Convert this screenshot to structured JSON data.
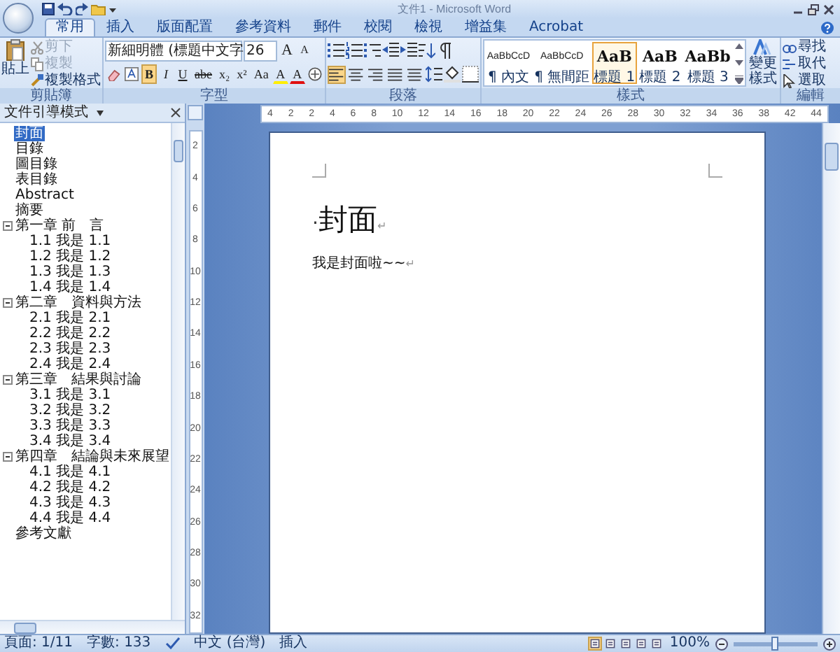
{
  "window": {
    "title": "文件1 - Microsoft Word"
  },
  "tabs": [
    {
      "label": "常用",
      "selected": true
    },
    {
      "label": "插入",
      "selected": false
    },
    {
      "label": "版面配置",
      "selected": false
    },
    {
      "label": "參考資料",
      "selected": false
    },
    {
      "label": "郵件",
      "selected": false
    },
    {
      "label": "校閱",
      "selected": false
    },
    {
      "label": "檢視",
      "selected": false
    },
    {
      "label": "增益集",
      "selected": false
    },
    {
      "label": "Acrobat",
      "selected": false
    }
  ],
  "ribbon": {
    "clipboard": {
      "label": "剪貼簿",
      "paste": "貼上",
      "items": [
        {
          "label": "剪下",
          "disabled": true
        },
        {
          "label": "複製",
          "disabled": true
        },
        {
          "label": "複製格式",
          "disabled": false
        }
      ]
    },
    "font": {
      "label": "字型",
      "font_name": "新細明體 (標題中文字",
      "font_size": "26",
      "size_buttons": [
        "A",
        "A"
      ],
      "format_buttons": [
        {
          "label": "B",
          "selected": true
        },
        {
          "label": "I",
          "selected": false
        },
        {
          "label": "U",
          "selected": false
        },
        {
          "label": "abe",
          "selected": false
        },
        {
          "label": "x₂",
          "selected": false
        },
        {
          "label": "x²",
          "selected": false
        },
        {
          "label": "Aa",
          "selected": false
        }
      ],
      "color_buttons": [
        "A",
        "A"
      ]
    },
    "paragraph": {
      "label": "段落",
      "alignment": [
        {
          "selected": true
        },
        {
          "selected": false
        },
        {
          "selected": false
        },
        {
          "selected": false
        },
        {
          "selected": false
        }
      ]
    },
    "styles": {
      "label": "樣式",
      "items": [
        {
          "preview": "AaBbCcD",
          "name": "¶ 內文",
          "kind": "body",
          "selected": false
        },
        {
          "preview": "AaBbCcD",
          "name": "¶ 無間距",
          "kind": "body",
          "selected": false
        },
        {
          "preview": "AaB",
          "name": "標題 1",
          "kind": "heading",
          "selected": true
        },
        {
          "preview": "AaB",
          "name": "標題 2",
          "kind": "heading",
          "selected": false
        },
        {
          "preview": "AaBb",
          "name": "標題 3",
          "kind": "heading",
          "selected": false
        }
      ],
      "change_styles": "變更樣式"
    },
    "editing": {
      "label": "編輯",
      "items": [
        "尋找",
        "取代",
        "選取"
      ]
    }
  },
  "nav_pane": {
    "mode": "文件引導模式",
    "items": [
      {
        "label": "封面",
        "selected": true
      },
      {
        "label": "目錄",
        "selected": false
      },
      {
        "label": "圖目錄",
        "selected": false
      },
      {
        "label": "表目錄",
        "selected": false
      },
      {
        "label": "Abstract",
        "selected": false
      },
      {
        "label": "摘要",
        "selected": false
      },
      {
        "label": "第一章 前　言",
        "selected": false,
        "expanded": true,
        "children": [
          {
            "label": "1.1 我是 1.1",
            "selected": false
          },
          {
            "label": "1.2 我是 1.2",
            "selected": false
          },
          {
            "label": "1.3 我是 1.3",
            "selected": false
          },
          {
            "label": "1.4 我是 1.4",
            "selected": false
          }
        ]
      },
      {
        "label": "第二章　資料與方法",
        "selected": false,
        "expanded": true,
        "children": [
          {
            "label": "2.1 我是 2.1",
            "selected": false
          },
          {
            "label": "2.2 我是 2.2",
            "selected": false
          },
          {
            "label": "2.3 我是 2.3",
            "selected": false
          },
          {
            "label": "2.4 我是 2.4",
            "selected": false
          }
        ]
      },
      {
        "label": "第三章　結果與討論",
        "selected": false,
        "expanded": true,
        "children": [
          {
            "label": "3.1 我是 3.1",
            "selected": false
          },
          {
            "label": "3.2 我是 3.2",
            "selected": false
          },
          {
            "label": "3.3 我是 3.3",
            "selected": false
          },
          {
            "label": "3.4 我是 3.4",
            "selected": false
          }
        ]
      },
      {
        "label": "第四章　結論與未來展望",
        "selected": false,
        "expanded": true,
        "children": [
          {
            "label": "4.1 我是 4.1",
            "selected": false
          },
          {
            "label": "4.2 我是 4.2",
            "selected": false
          },
          {
            "label": "4.3 我是 4.3",
            "selected": false
          },
          {
            "label": "4.4 我是 4.4",
            "selected": false
          }
        ]
      },
      {
        "label": "參考文獻",
        "selected": false
      }
    ]
  },
  "ruler": {
    "ticks": [
      "4",
      "2",
      "2",
      "4",
      "6",
      "8",
      "10",
      "12",
      "14",
      "16",
      "18",
      "20",
      "22",
      "24",
      "26",
      "28",
      "30",
      "32",
      "34",
      "36",
      "38",
      "42",
      "44"
    ]
  },
  "vertical_ruler": {
    "ticks": [
      "2",
      "4",
      "6",
      "8",
      "10",
      "12",
      "14",
      "16",
      "18",
      "20",
      "22",
      "24",
      "26",
      "28",
      "30",
      "32"
    ]
  },
  "document": {
    "heading_mark": "·",
    "heading": "封面",
    "heading_end": "↵",
    "body": "我是封面啦~~",
    "body_end": "↵"
  },
  "status_bar": {
    "page": "頁面: 1/11",
    "words": "字數: 133",
    "language": "中文 (台灣)",
    "mode": "插入",
    "views": [
      {
        "selected": true
      },
      {
        "selected": false
      },
      {
        "selected": false
      },
      {
        "selected": false
      },
      {
        "selected": false
      }
    ],
    "zoom": "100%",
    "zoom_slider": {
      "level": 0.5
    }
  }
}
